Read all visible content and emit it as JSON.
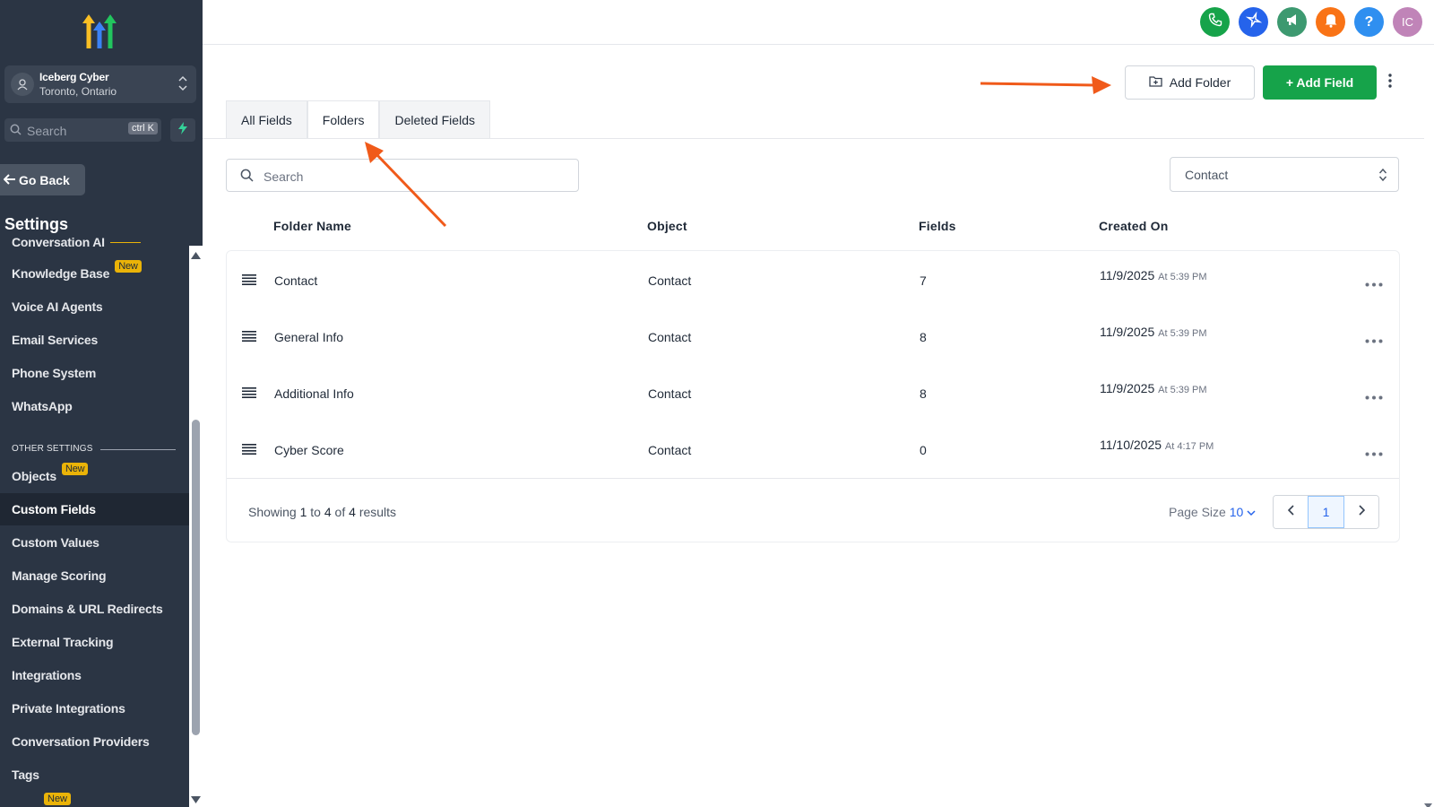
{
  "colors": {
    "sidebar_bg": "#2b3544",
    "primary_green": "#16a34a",
    "accent_blue": "#2563eb",
    "annotation_orange": "#f05a1a",
    "badge_yellow": "#eab308"
  },
  "account": {
    "name": "Iceberg Cyber",
    "location": "Toronto, Ontario"
  },
  "sidebar": {
    "search_placeholder": "Search",
    "search_shortcut": "ctrl K",
    "go_back": "Go Back",
    "settings_title": "Settings",
    "items": [
      {
        "label": "Conversation AI"
      },
      {
        "label": "Knowledge Base",
        "badge": "New"
      },
      {
        "label": "Voice AI Agents"
      },
      {
        "label": "Email Services"
      },
      {
        "label": "Phone System"
      },
      {
        "label": "WhatsApp"
      },
      {
        "label": "Objects",
        "badge": "New"
      },
      {
        "label": "Custom Fields"
      },
      {
        "label": "Custom Values"
      },
      {
        "label": "Manage Scoring"
      },
      {
        "label": "Domains & URL Redirects"
      },
      {
        "label": "External Tracking"
      },
      {
        "label": "Integrations"
      },
      {
        "label": "Private Integrations"
      },
      {
        "label": "Conversation Providers"
      },
      {
        "label": "Tags",
        "badge": "New"
      }
    ],
    "section_other": "OTHER SETTINGS",
    "active_item": "Custom Fields"
  },
  "topbar": {
    "icons": [
      "phone-icon",
      "sparkle-icon",
      "megaphone-icon",
      "bell-icon",
      "help-icon",
      "user-avatar"
    ],
    "help_label": "?",
    "avatar_initials": "IC"
  },
  "toolbar": {
    "add_folder": "Add Folder",
    "add_field": "+ Add Field"
  },
  "tabs": [
    {
      "label": "All Fields"
    },
    {
      "label": "Folders"
    },
    {
      "label": "Deleted Fields"
    }
  ],
  "active_tab": "Folders",
  "filters": {
    "search_placeholder": "Search",
    "object_selected": "Contact"
  },
  "table": {
    "headers": [
      "Folder Name",
      "Object",
      "Fields",
      "Created On"
    ],
    "rows": [
      {
        "name": "Contact",
        "object": "Contact",
        "fields": "7",
        "date": "11/9/2025",
        "time": "At 5:39 PM"
      },
      {
        "name": "General Info",
        "object": "Contact",
        "fields": "8",
        "date": "11/9/2025",
        "time": "At 5:39 PM"
      },
      {
        "name": "Additional Info",
        "object": "Contact",
        "fields": "8",
        "date": "11/9/2025",
        "time": "At 5:39 PM"
      },
      {
        "name": "Cyber Score",
        "object": "Contact",
        "fields": "0",
        "date": "11/10/2025",
        "time": "At 4:17 PM"
      }
    ]
  },
  "pagination": {
    "showing_prefix": "Showing",
    "from": "1",
    "to_word": "to",
    "to": "4",
    "of_word": "of",
    "total": "4",
    "suffix": "results",
    "page_size_label": "Page Size",
    "page_size": "10",
    "current_page": "1"
  }
}
